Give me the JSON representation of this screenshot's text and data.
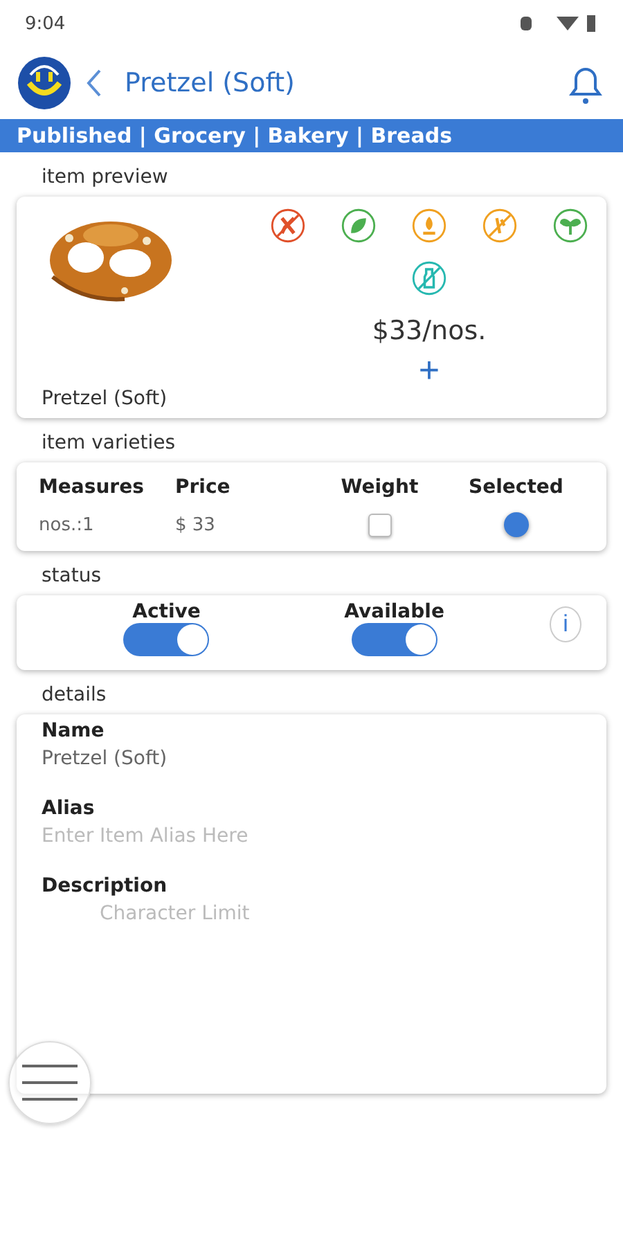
{
  "status_bar": {
    "time": "9:04"
  },
  "header": {
    "title": "Pretzel (Soft)"
  },
  "breadcrumb": "Published | Grocery | Bakery | Breads",
  "preview": {
    "section": "item preview",
    "name": "Pretzel (Soft)",
    "price": "$33/nos.",
    "add": "+",
    "diet_icons": [
      {
        "kind": "no-meat",
        "color": "#e0502a"
      },
      {
        "kind": "leaf",
        "color": "#4caf50"
      },
      {
        "kind": "grain",
        "color": "#f0a020"
      },
      {
        "kind": "no-grain",
        "color": "#f0a020"
      },
      {
        "kind": "sprout",
        "color": "#4caf50"
      },
      {
        "kind": "no-bottle",
        "color": "#26b8b0"
      }
    ]
  },
  "varieties": {
    "section": "item varieties",
    "columns": [
      "Measures",
      "Price",
      "Weight",
      "Selected"
    ],
    "rows": [
      {
        "measure": "nos.:1",
        "price": "$ 33",
        "weight_checked": false,
        "selected": true
      }
    ]
  },
  "status": {
    "section": "status",
    "toggles": [
      {
        "label": "Active",
        "on": true
      },
      {
        "label": "Available",
        "on": true
      }
    ],
    "info": "i"
  },
  "details": {
    "section": "details",
    "fields": [
      {
        "label": "Name",
        "value": "Pretzel (Soft)"
      },
      {
        "label": "Alias",
        "placeholder": "Enter Item Alias Here"
      },
      {
        "label": "Description",
        "placeholder": "Character Limit"
      }
    ]
  }
}
